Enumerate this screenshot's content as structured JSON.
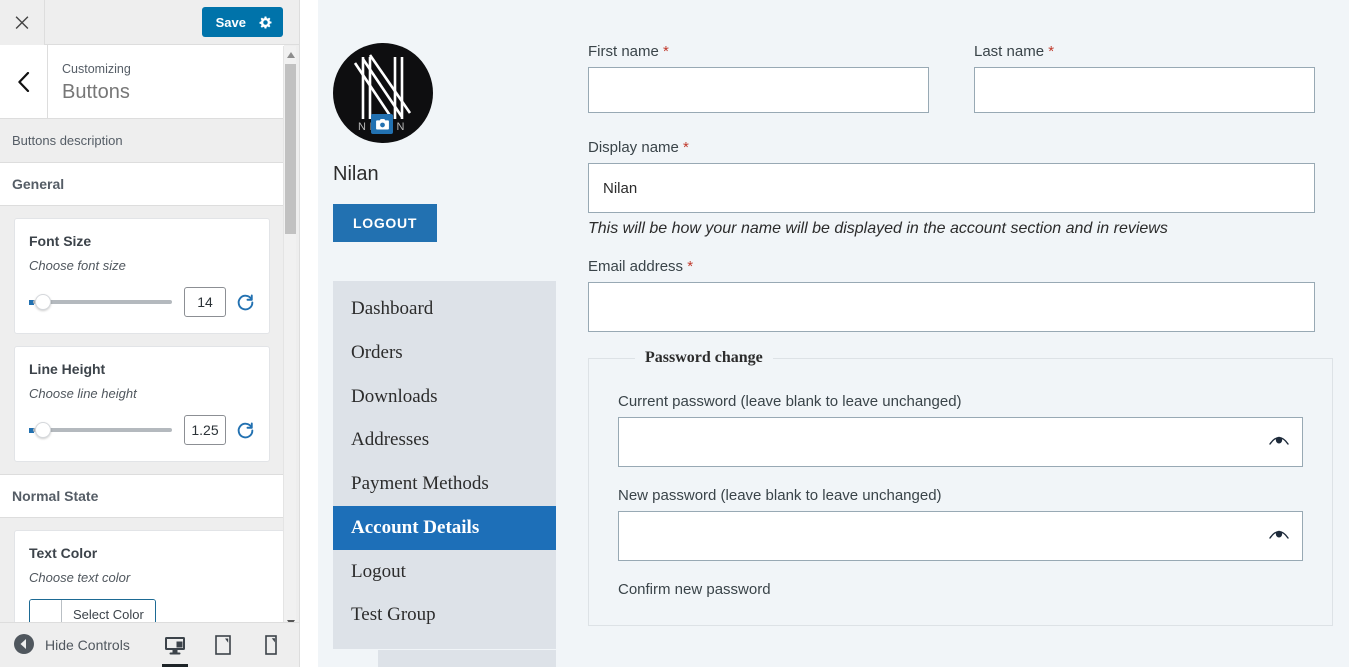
{
  "customizer": {
    "close_icon": "close-icon",
    "save_label": "Save",
    "gear_icon": "gear-icon",
    "back_icon": "chevron-left-icon",
    "panel_eyebrow": "Customizing",
    "panel_name": "Buttons",
    "section_description": "Buttons description",
    "accordion_general": "General",
    "accordion_normal_state": "Normal State",
    "controls": [
      {
        "title": "Font Size",
        "subtitle": "Choose font size",
        "value": "14",
        "reset_icon": "reset-icon"
      },
      {
        "title": "Line Height",
        "subtitle": "Choose line height",
        "value": "1.25",
        "reset_icon": "reset-icon"
      }
    ],
    "color_control": {
      "title": "Text Color",
      "subtitle": "Choose text color",
      "button_label": "Select Color",
      "swatch": "#ffffff"
    },
    "footer": {
      "hide_controls_label": "Hide Controls",
      "collapse_icon": "collapse-arrow-icon",
      "devices": [
        {
          "name": "desktop-icon",
          "active": true
        },
        {
          "name": "tablet-icon",
          "active": false
        },
        {
          "name": "mobile-icon",
          "active": false
        }
      ]
    },
    "colors": {
      "save_button": "#0073aa",
      "accent": "#2271b1",
      "panel_bg": "#eeeeee"
    }
  },
  "preview": {
    "account": {
      "avatar_alt": "Nilan logo avatar",
      "avatar_badge_icon": "camera-icon",
      "display_name": "Nilan",
      "logout_label": "LOGOUT"
    },
    "nav": [
      {
        "label": "Dashboard",
        "active": false
      },
      {
        "label": "Orders",
        "active": false
      },
      {
        "label": "Downloads",
        "active": false
      },
      {
        "label": "Addresses",
        "active": false
      },
      {
        "label": "Payment Methods",
        "active": false
      },
      {
        "label": "Account Details",
        "active": true
      },
      {
        "label": "Logout",
        "active": false
      },
      {
        "label": "Test Group",
        "active": false
      }
    ],
    "form": {
      "first_name": {
        "label": "First name",
        "required": "*",
        "value": ""
      },
      "last_name": {
        "label": "Last name",
        "required": "*",
        "value": ""
      },
      "display_name": {
        "label": "Display name",
        "required": "*",
        "value": "Nilan"
      },
      "display_name_help": "This will be how your name will be displayed in the account section and in reviews",
      "email": {
        "label": "Email address",
        "required": "*",
        "value": ""
      },
      "password_section": {
        "legend": "Password change",
        "current_password": {
          "label": "Current password (leave blank to leave unchanged)",
          "value": "",
          "toggle_icon": "eye-icon"
        },
        "new_password": {
          "label": "New password (leave blank to leave unchanged)",
          "value": "",
          "toggle_icon": "eye-icon"
        },
        "confirm_password": {
          "label": "Confirm new password",
          "value": "",
          "toggle_icon": "eye-icon"
        }
      }
    },
    "colors": {
      "page_bg": "#f1f5f8",
      "nav_bg": "#dde2e8",
      "nav_active": "#1d6fb8",
      "input_border": "#98a9b4",
      "required": "#c0392b"
    }
  }
}
